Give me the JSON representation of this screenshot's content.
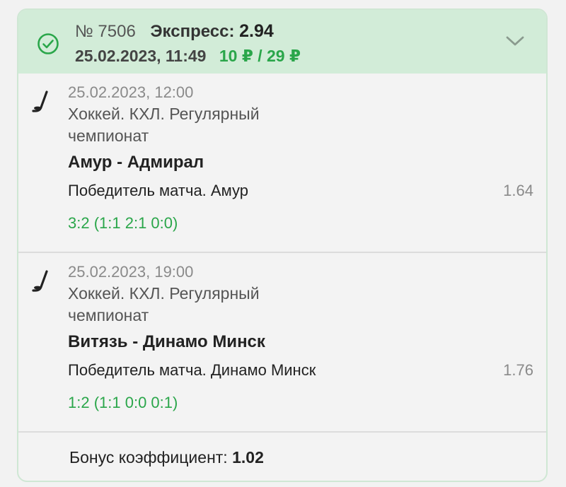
{
  "bet": {
    "number": "№ 7506",
    "type_label": "Экспресс:",
    "total_odds": "2.94",
    "datetime": "25.02.2023, 11:49",
    "amount": "10 ₽ / 29 ₽",
    "status_icon": "check-circle-icon",
    "expand_icon": "chevron-down-icon"
  },
  "events": [
    {
      "sport_icon": "hockey-stick-icon",
      "date": "25.02.2023, 12:00",
      "league": "Хоккей. КХЛ. Регулярный чемпионат",
      "teams": "Амур - Адмирал",
      "market": "Победитель матча. Амур",
      "odds": "1.64",
      "score": "3:2 (1:1 2:1 0:0)"
    },
    {
      "sport_icon": "hockey-stick-icon",
      "date": "25.02.2023, 19:00",
      "league": "Хоккей. КХЛ. Регулярный чемпионат",
      "teams": "Витязь - Динамо Минск",
      "market": "Победитель матча. Динамо Минск",
      "odds": "1.76",
      "score": "1:2 (1:1 0:0 0:1)"
    }
  ],
  "bonus": {
    "label": "Бонус коэффициент:",
    "value": "1.02"
  },
  "colors": {
    "header_bg": "#d2ecd8",
    "accent_green": "#2aa64a",
    "card_bg": "#f3f3f3"
  }
}
